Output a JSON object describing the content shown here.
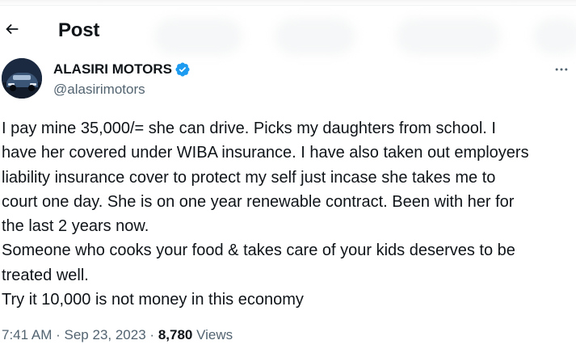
{
  "header": {
    "title": "Post",
    "back_icon": "arrow-left-icon"
  },
  "author": {
    "name": "ALASIRI MOTORS",
    "handle": "@alasirimotors",
    "verified": true,
    "verified_color": "#1d9bf0",
    "more_icon": "more-horizontal-icon"
  },
  "tweet": {
    "lines": [
      "I pay mine 35,000/= she can drive. Picks my daughters from school. I",
      "have her covered under WIBA insurance. I have also taken out employers",
      "liability insurance cover to protect my self just incase she takes me to",
      "court one day. She is on one year renewable contract. Been with her for",
      "the last 2 years now.",
      "Someone who cooks your food & takes care of your kids deserves to be",
      "treated well.",
      "Try it 10,000 is not money in this economy"
    ]
  },
  "meta": {
    "time": "7:41 AM",
    "separator": "·",
    "date": "Sep 23, 2023",
    "views_count": "8,780",
    "views_label": "Views"
  },
  "colors": {
    "text": "#0f1419",
    "secondary": "#536471",
    "accent": "#1d9bf0"
  }
}
